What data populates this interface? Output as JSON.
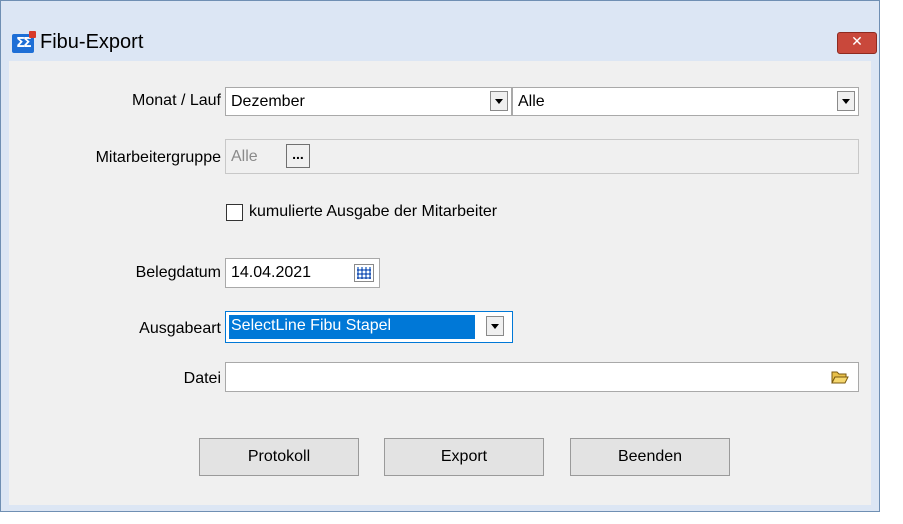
{
  "window": {
    "title": "Fibu-Export",
    "close_glyph": "✕"
  },
  "form": {
    "monat_lauf": {
      "label": "Monat / Lauf",
      "month_value": "Dezember",
      "run_value": "Alle"
    },
    "mitarbeitergruppe": {
      "label": "Mitarbeitergruppe",
      "value": "Alle",
      "browse_label": "..."
    },
    "kumuliert": {
      "label": "kumulierte Ausgabe der Mitarbeiter",
      "checked": false
    },
    "belegdatum": {
      "label": "Belegdatum",
      "value": "14.04.2021"
    },
    "ausgabeart": {
      "label": "Ausgabeart",
      "value": "SelectLine Fibu Stapel"
    },
    "datei": {
      "label": "Datei",
      "value": ""
    }
  },
  "buttons": {
    "protokoll": "Protokoll",
    "export": "Export",
    "beenden": "Beenden"
  },
  "colors": {
    "selection": "#0078d7",
    "close_button": "#c9483b",
    "title_bar": "#dce6f4"
  },
  "icons": [
    "app-sigma-icon",
    "close-icon",
    "chevron-down-icon",
    "calendar-icon",
    "folder-open-icon"
  ]
}
